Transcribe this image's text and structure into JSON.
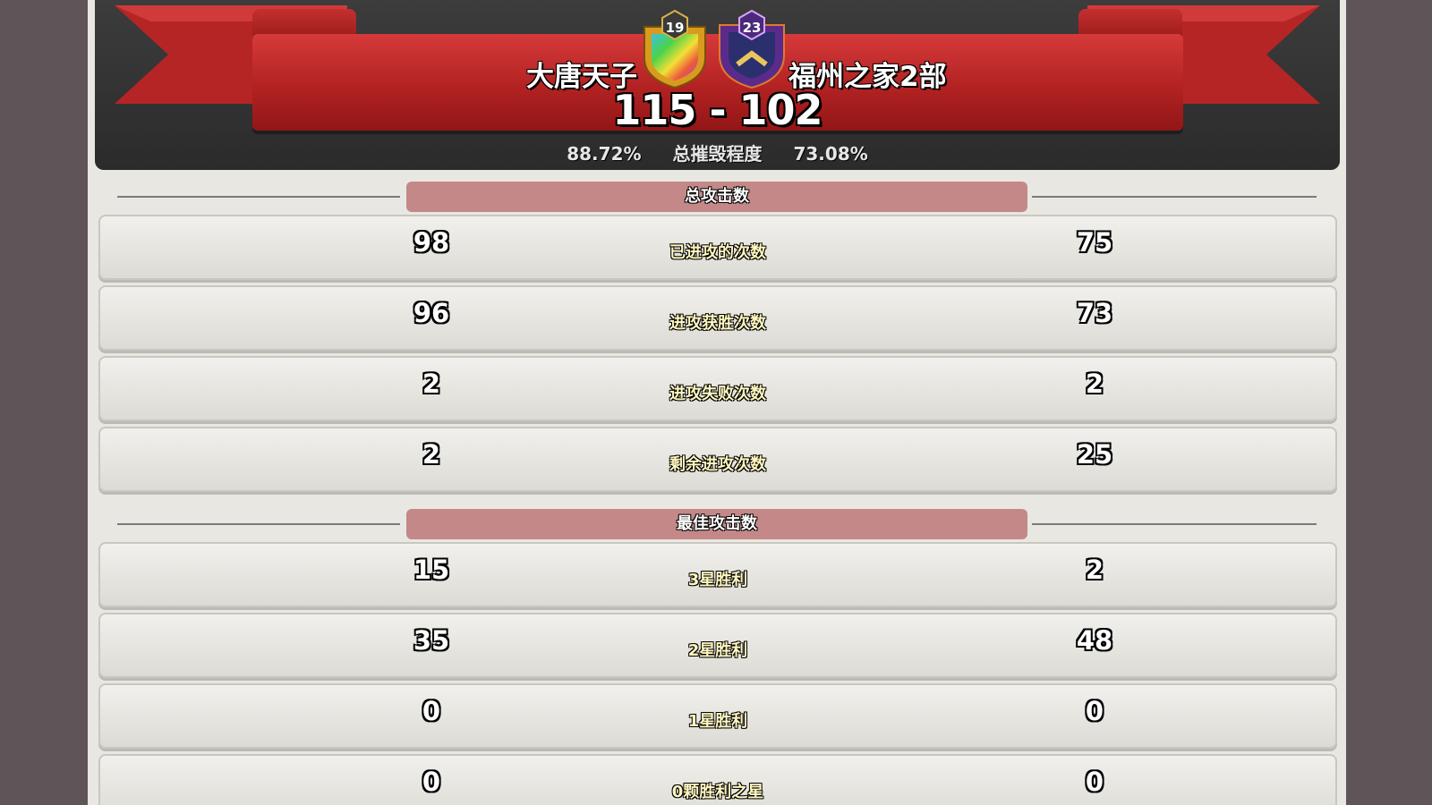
{
  "war": {
    "left_clan": {
      "name": "大唐天子",
      "level": "19"
    },
    "right_clan": {
      "name": "福州之家2部",
      "level": "23"
    },
    "score": "115 - 102",
    "left_destruction": "88.72%",
    "destruction_label": "总摧毁程度",
    "right_destruction": "73.08%"
  },
  "sections": [
    {
      "title": "总攻击数",
      "rows": [
        {
          "label": "已进攻的次数",
          "left": "98",
          "right": "75"
        },
        {
          "label": "进攻获胜次数",
          "left": "96",
          "right": "73"
        },
        {
          "label": "进攻失败次数",
          "left": "2",
          "right": "2"
        },
        {
          "label": "剩余进攻次数",
          "left": "2",
          "right": "25"
        }
      ]
    },
    {
      "title": "最佳攻击数",
      "rows": [
        {
          "label": "3星胜利",
          "left": "15",
          "right": "2"
        },
        {
          "label": "2星胜利",
          "left": "35",
          "right": "48"
        },
        {
          "label": "1星胜利",
          "left": "0",
          "right": "0"
        },
        {
          "label": "0颗胜利之星",
          "left": "0",
          "right": "0"
        }
      ]
    }
  ],
  "colors": {
    "ribbon": "#c02828",
    "section_pill": "#c48888",
    "header_bg": "#333333"
  },
  "icons": {
    "left_badge": "rainbow-shield-clan-badge-icon",
    "right_badge": "purple-shield-clan-badge-icon"
  }
}
